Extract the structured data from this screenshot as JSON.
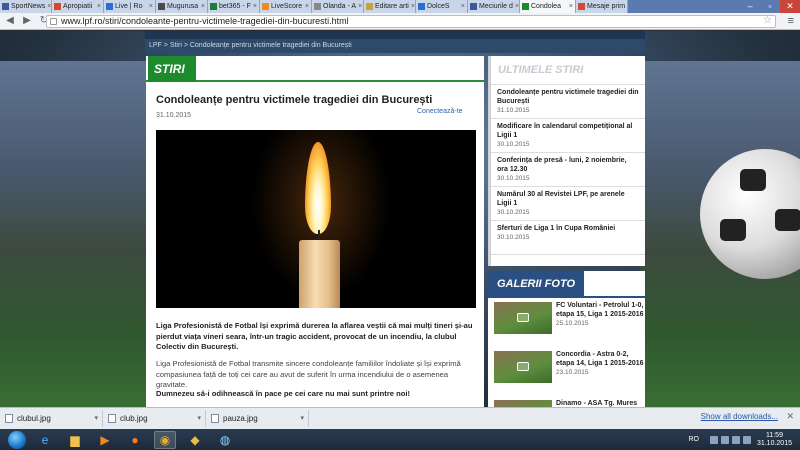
{
  "browser": {
    "tabs": [
      {
        "label": "SportNews",
        "color": "#3b5998"
      },
      {
        "label": "Apropiatii",
        "color": "#d24a2a"
      },
      {
        "label": "Live | Ro",
        "color": "#2a6fd2"
      },
      {
        "label": "Mugurusa",
        "color": "#4b4b4b"
      },
      {
        "label": "bet365 - F",
        "color": "#1d7a3c"
      },
      {
        "label": "LiveScore",
        "color": "#f08a1c"
      },
      {
        "label": "Olanda - A",
        "color": "#888888"
      },
      {
        "label": "Editare arti",
        "color": "#c8a23a"
      },
      {
        "label": "DolceS",
        "color": "#2a6fd2"
      },
      {
        "label": "Meciurile d",
        "color": "#3b5998"
      },
      {
        "label": "Condolea",
        "color": "#1e8a2e"
      },
      {
        "label": "Mesaje prim",
        "color": "#d14836"
      }
    ],
    "active_tab_index": 10,
    "url": "www.lpf.ro/stiri/condoleante-pentru-victimele-tragediei-din-bucuresti.html"
  },
  "breadcrumb": "LPF > Stiri > Condoleanțe pentru victimele tragediei din București",
  "section_label": "STIRI",
  "article": {
    "title": "Condoleanțe pentru victimele tragediei din București",
    "date": "31.10.2015",
    "connect_label": "Conectează-te",
    "paragraph1": "Liga Profesionistă de Fotbal își exprimă durerea la aflarea veștii că mai mulți tineri și-au pierdut viața vineri seara, într-un tragic accident, provocat de un incendiu, la clubul Colectiv din București.",
    "paragraph2": "Liga Profesionistă de Fotbal transmite sincere condoleanțe familiilor îndoliate și își exprimă compasiunea față de toți cei care au avut de suferit în urma incendiului de o asemenea gravitate.",
    "paragraph3": "Dumnezeu să-i odihnească în pace pe cei care nu mai sunt printre noi!"
  },
  "sidebar": {
    "latest_title": "ULTIMELE STIRI",
    "news": [
      {
        "title": "Condoleanțe pentru victimele tragediei din București",
        "date": "31.10.2015"
      },
      {
        "title": "Modificare în calendarul competițional al Ligii 1",
        "date": "30.10.2015"
      },
      {
        "title": "Conferința de presă - luni, 2 noiembrie, ora 12.30",
        "date": "30.10.2015"
      },
      {
        "title": "Numărul 30 al Revistei LPF, pe arenele Ligii 1",
        "date": "30.10.2015"
      },
      {
        "title": "Sferturi de Liga 1 în Cupa României",
        "date": "30.10.2015"
      }
    ],
    "gallery_title": "GALERII FOTO",
    "gallery": [
      {
        "title": "FC Voluntari - Petrolul 1-0, etapa 15, Liga 1 2015-2016",
        "date": "25.10.2015"
      },
      {
        "title": "Concordia - Astra 0-2, etapa 14, Liga 1 2015-2016",
        "date": "23.10.2015"
      },
      {
        "title": "Dinamo - ASA Tg. Mures 2-1, etapa 14, Liga 1",
        "date": ""
      }
    ]
  },
  "downloads": {
    "items": [
      "clubul.jpg",
      "club.jpg",
      "pauza.jpg"
    ],
    "show_all": "Show all downloads..."
  },
  "taskbar": {
    "lang": "RO",
    "time": "11:59",
    "date": "31.10.2015"
  }
}
